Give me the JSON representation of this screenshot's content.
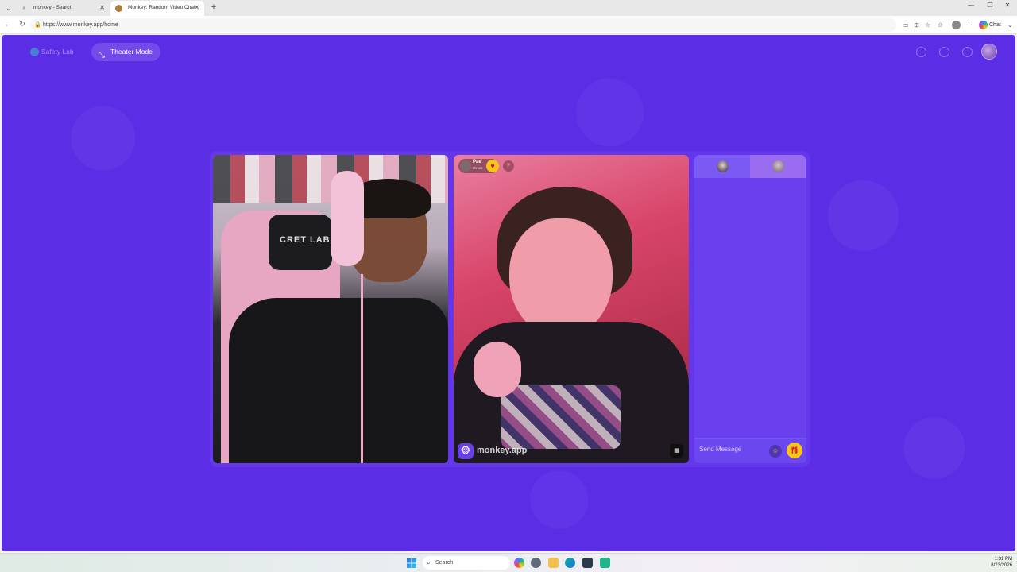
{
  "browser": {
    "tabs": [
      {
        "title": "monkey - Search",
        "favicon": "search-icon"
      },
      {
        "title": "Monkey: Random Video Chat",
        "favicon": "monkey-icon",
        "active": true
      }
    ],
    "url": "https://www.monkey.app/home",
    "chat_button_label": "Chat"
  },
  "page": {
    "accent_color": "#5b2ee6",
    "header": {
      "safety_lab_label": "Safety Lab",
      "theater_mode_label": "Theater Mode"
    },
    "peer": {
      "name": "Pae",
      "subtitle": "Illinois"
    },
    "brand_logo_text": "monkey.app",
    "chat_panel": {
      "message_placeholder": "Send Message"
    }
  },
  "taskbar": {
    "search_placeholder": "Search",
    "time": "1:31 PM",
    "date": "8/23/2026"
  }
}
